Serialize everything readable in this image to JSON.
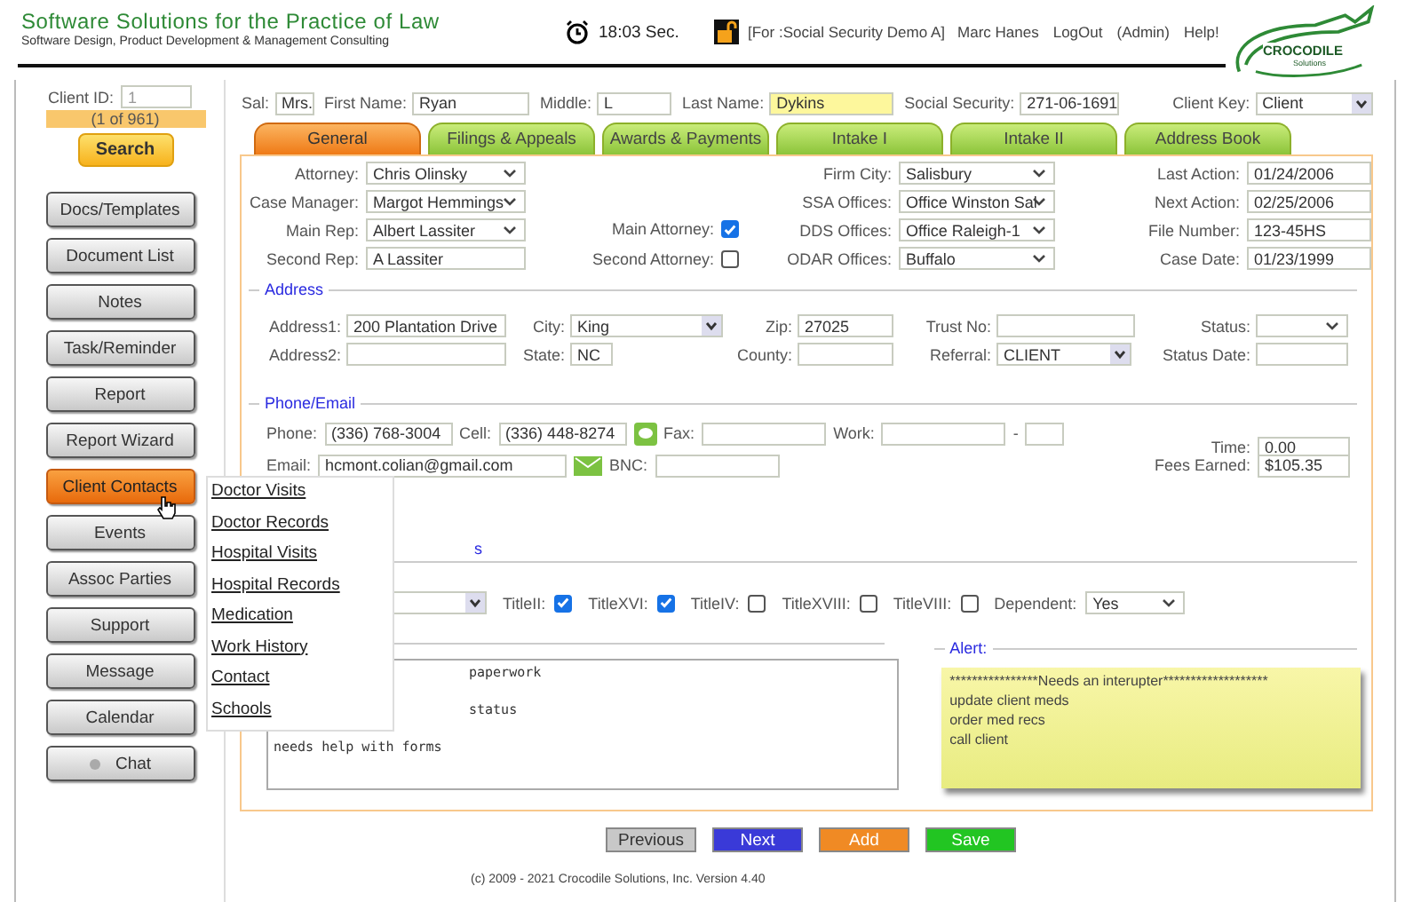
{
  "header": {
    "title": "Software Solutions for the Practice of Law",
    "subtitle": "Software Design, Product Development & Management Consulting",
    "timer": "18:03 Sec.",
    "session": "[For :Social Security Demo A]",
    "user": "Marc Hanes",
    "links": [
      "LogOut",
      "(Admin)",
      "Help!"
    ],
    "logo": {
      "name": "CROCODILE",
      "tagline": "Solutions"
    }
  },
  "sidebar": {
    "client_id_label": "Client ID:",
    "client_id": "1",
    "count": "(1 of 961)",
    "search": "Search",
    "buttons": [
      {
        "label": "Docs/Templates",
        "selected": false
      },
      {
        "label": "Document List",
        "selected": false
      },
      {
        "label": "Notes",
        "selected": false
      },
      {
        "label": "Task/Reminder",
        "selected": false
      },
      {
        "label": "Report",
        "selected": false
      },
      {
        "label": "Report Wizard",
        "selected": false
      },
      {
        "label": "Client Contacts",
        "selected": true
      },
      {
        "label": "Events",
        "selected": false
      },
      {
        "label": "Assoc Parties",
        "selected": false
      },
      {
        "label": "Support",
        "selected": false
      },
      {
        "label": "Message",
        "selected": false
      },
      {
        "label": "Calendar",
        "selected": false
      },
      {
        "label": "Chat",
        "selected": false,
        "kind": "chat"
      }
    ]
  },
  "client_bar": [
    {
      "label": "Sal:",
      "value": "Mrs.",
      "kind": "input",
      "highlighted": false
    },
    {
      "label": "First Name:",
      "value": "Ryan",
      "kind": "input",
      "highlighted": false
    },
    {
      "label": "Middle:",
      "value": "L",
      "kind": "input",
      "highlighted": false
    },
    {
      "label": "Last Name:",
      "value": "Dykins",
      "kind": "input",
      "highlighted": true
    },
    {
      "label": "Social Security:",
      "value": "271-06-1691",
      "kind": "input",
      "highlighted": false
    },
    {
      "label": "Client Key:",
      "value": "Client",
      "kind": "combo",
      "highlighted": false
    }
  ],
  "tabs": [
    {
      "label": "General",
      "selected": true
    },
    {
      "label": "Filings & Appeals",
      "selected": false
    },
    {
      "label": "Awards & Payments",
      "selected": false
    },
    {
      "label": "Intake I",
      "selected": false
    },
    {
      "label": "Intake II",
      "selected": false
    },
    {
      "label": "Address Book",
      "selected": false
    }
  ],
  "general": {
    "staff": [
      {
        "label": "Attorney:",
        "value": "Chris Olinsky",
        "kind": "select"
      },
      {
        "label": "Case Manager:",
        "value": "Margot Hemmings",
        "kind": "select"
      },
      {
        "label": "Main Rep:",
        "value": "Albert Lassiter",
        "kind": "select"
      },
      {
        "label": "Second Rep:",
        "value": "A Lassiter",
        "kind": "input"
      }
    ],
    "attorney_checks": [
      {
        "label": "Main Attorney:",
        "checked": true
      },
      {
        "label": "Second Attorney:",
        "checked": false
      }
    ],
    "offices": [
      {
        "label": "Firm City:",
        "value": "Salisbury",
        "kind": "select"
      },
      {
        "label": "SSA Offices:",
        "value": "Office Winston Sal",
        "kind": "select"
      },
      {
        "label": "DDS Offices:",
        "value": "Office Raleigh-1",
        "kind": "select"
      },
      {
        "label": "ODAR Offices:",
        "value": "Buffalo",
        "kind": "select"
      }
    ],
    "dates": [
      {
        "label": "Last Action:",
        "value": "01/24/2006"
      },
      {
        "label": "Next Action:",
        "value": "02/25/2006"
      },
      {
        "label": "File Number:",
        "value": "123-45HS"
      },
      {
        "label": "Case Date:",
        "value": "01/23/1999"
      }
    ]
  },
  "address": {
    "heading": "Address",
    "address1_label": "Address1:",
    "address1": "200 Plantation Drive",
    "address2_label": "Address2:",
    "city_label": "City:",
    "city": "King",
    "state_label": "State:",
    "state": "NC",
    "zip_label": "Zip:",
    "zip": "27025",
    "county_label": "County:",
    "trust_label": "Trust No:",
    "referral_label": "Referral:",
    "referral": "CLIENT",
    "status_label": "Status:",
    "status_date_label": "Status Date:"
  },
  "contact": {
    "heading": "Phone/Email",
    "phone_label": "Phone:",
    "phone": "(336) 768-3004",
    "cell_label": "Cell:",
    "cell": "(336) 448-8274",
    "fax_label": "Fax:",
    "work_label": "Work:",
    "work_sep": "-",
    "email_label": "Email:",
    "email": "hcmont.colian@gmail.com",
    "bnc_label": "BNC:",
    "time_label": "Time:",
    "time": "0.00",
    "fees_label": "Fees Earned:",
    "fees": "$105.35"
  },
  "titles": {
    "heading": "s",
    "checks": [
      {
        "label": "TitleII:",
        "checked": true
      },
      {
        "label": "TitleXVI:",
        "checked": true
      },
      {
        "label": "TitleIV:",
        "checked": false
      },
      {
        "label": "TitleXVIII:",
        "checked": false
      },
      {
        "label": "TitleVIII:",
        "checked": false
      }
    ],
    "dependent_label": "Dependent:",
    "dependent": "Yes"
  },
  "notes": [
    "paperwork",
    "status",
    "needs help with forms"
  ],
  "alert": {
    "heading": "Alert:",
    "lines": [
      "****************Needs an interupter*******************",
      "update client meds",
      "order med recs",
      "call client"
    ]
  },
  "actions": [
    {
      "label": "Previous",
      "color": "#c8c8c8"
    },
    {
      "label": "Next",
      "color": "#3a3ad8"
    },
    {
      "label": "Add",
      "color": "#f08a24"
    },
    {
      "label": "Save",
      "color": "#22c522"
    }
  ],
  "footer": "(c) 2009 - 2021 Crocodile Solutions, Inc. Version 4.40",
  "menu": [
    "Doctor Visits",
    "Doctor Records",
    "Hospital Visits",
    "Hospital Records",
    "Medication",
    "Work History",
    "Contact",
    "Schools"
  ]
}
